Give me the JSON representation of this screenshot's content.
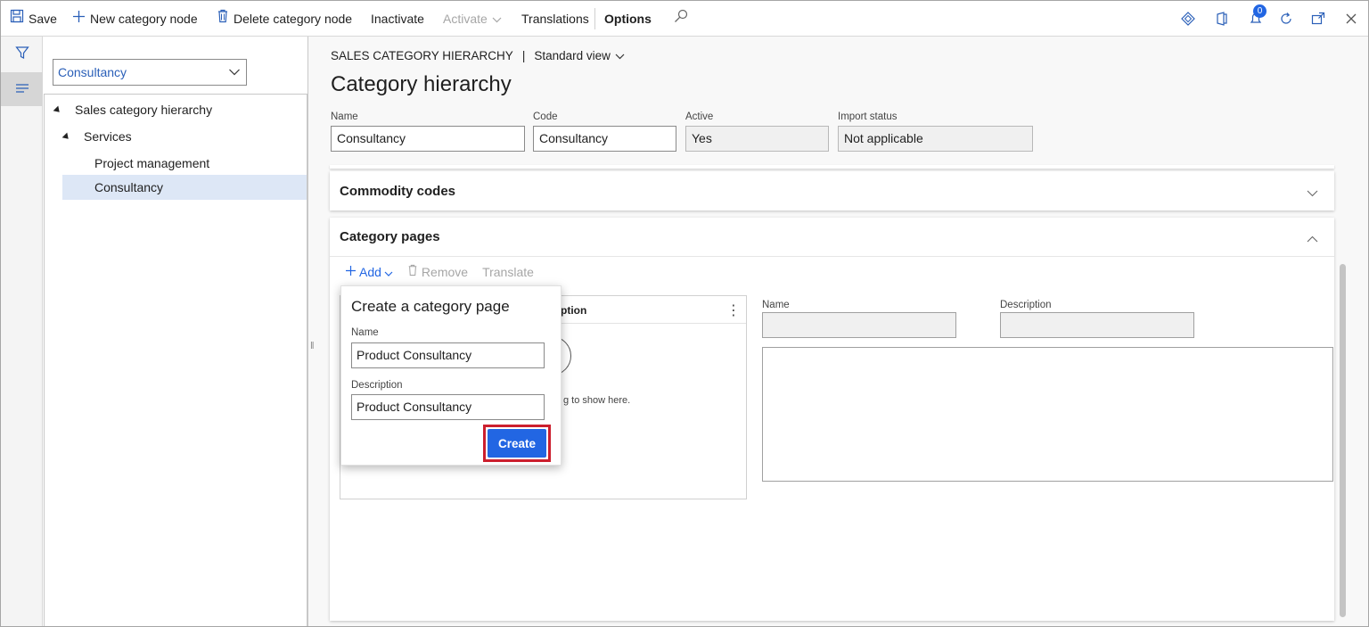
{
  "toolbar": {
    "save": "Save",
    "new_node": "New category node",
    "delete_node": "Delete category node",
    "inactivate": "Inactivate",
    "activate": "Activate",
    "translations": "Translations",
    "options": "Options",
    "notification_count": "0"
  },
  "tree": {
    "selector_value": "Consultancy",
    "nodes": [
      {
        "label": "Sales category hierarchy"
      },
      {
        "label": "Services"
      },
      {
        "label": "Project management"
      },
      {
        "label": "Consultancy"
      }
    ]
  },
  "header": {
    "breadcrumb": "SALES CATEGORY HIERARCHY",
    "separator": "|",
    "view": "Standard view",
    "title": "Category hierarchy"
  },
  "fields": {
    "name_label": "Name",
    "name_value": "Consultancy",
    "code_label": "Code",
    "code_value": "Consultancy",
    "active_label": "Active",
    "active_value": "Yes",
    "import_label": "Import status",
    "import_value": "Not applicable"
  },
  "commodity": {
    "title": "Commodity codes"
  },
  "category_pages": {
    "title": "Category pages",
    "add": "Add",
    "remove": "Remove",
    "translate": "Translate",
    "grid_col": "ription",
    "grid_empty": "g to show here.",
    "detail_name_label": "Name",
    "detail_desc_label": "Description"
  },
  "flyout": {
    "title": "Create a category page",
    "name_label": "Name",
    "name_value": "Product Consultancy",
    "desc_label": "Description",
    "desc_value": "Product Consultancy",
    "create": "Create"
  },
  "colors": {
    "accent": "#2266e3",
    "highlight": "#cc1f2e",
    "selection": "#dde7f6"
  }
}
